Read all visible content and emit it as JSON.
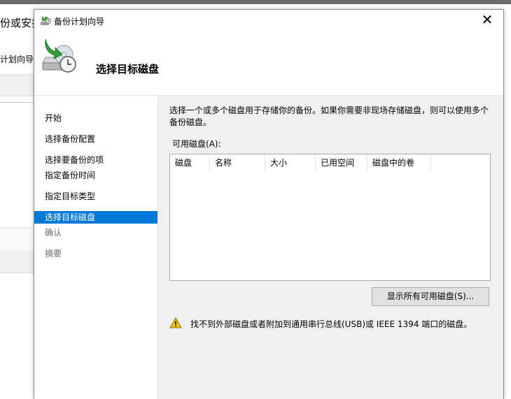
{
  "background_window": {
    "title_fragment": "份或安排",
    "subtitle_fragment": "计划向导或一"
  },
  "dialog": {
    "title": "备份计划向导",
    "close_glyph": "✕",
    "header_title": "选择目标磁盘",
    "nav": [
      {
        "label": "开始",
        "state": "normal"
      },
      {
        "label": "选择备份配置",
        "state": "normal"
      },
      {
        "label": "选择要备份的项",
        "state": "normal"
      },
      {
        "label": "指定备份时间",
        "state": "normal"
      },
      {
        "label": "指定目标类型",
        "state": "normal"
      },
      {
        "label": "选择目标磁盘",
        "state": "active"
      },
      {
        "label": "确认",
        "state": "disabled"
      },
      {
        "label": "摘要",
        "state": "disabled"
      }
    ],
    "description": "选择一个或多个磁盘用于存储你的备份。如果你需要非现场存储磁盘，则可以使用多个备份磁盘。",
    "available_disks_label": "可用磁盘(A):",
    "columns": [
      "磁盘",
      "名称",
      "大小",
      "已用空间",
      "磁盘中的卷"
    ],
    "show_all_button": "显示所有可用磁盘(S)...",
    "warning": "找不到外部磁盘或者附加到通用串行总线(USB)或 IEEE 1394 端口的磁盘。"
  },
  "colors": {
    "accent": "#0078d7",
    "content_bg": "#f0f0f0",
    "warning_yellow": "#f5c400"
  },
  "icons": [
    "backup-wizard-app-icon",
    "backup-disk-clock-icon",
    "close-icon",
    "warning-icon"
  ]
}
